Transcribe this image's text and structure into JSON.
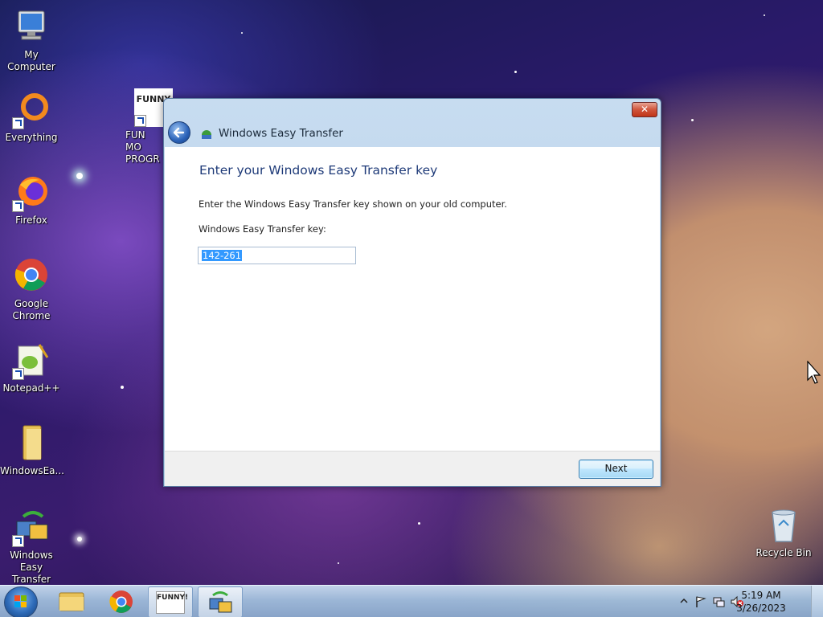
{
  "desktop": {
    "icons": [
      {
        "label": "My Computer",
        "icon": "computer-icon"
      },
      {
        "label": "Everything",
        "icon": "everything-search-icon"
      },
      {
        "label": "FUN MO PROGR",
        "icon": "funny-image-icon",
        "image_text": "FUNNY"
      },
      {
        "label": "Firefox",
        "icon": "firefox-icon"
      },
      {
        "label": "Google Chrome",
        "icon": "chrome-icon"
      },
      {
        "label": "Notepad++",
        "icon": "notepadpp-icon"
      },
      {
        "label": "WindowsEa...",
        "icon": "folder-icon"
      },
      {
        "label": "Windows Easy Transfer",
        "icon": "easy-transfer-icon"
      },
      {
        "label": "Recycle Bin",
        "icon": "recycle-bin-icon"
      }
    ]
  },
  "dialog": {
    "title": "Windows Easy Transfer",
    "close_label": "✕",
    "heading": "Enter your Windows Easy Transfer key",
    "instruction": "Enter the Windows Easy Transfer key shown on your old computer.",
    "key_label": "Windows Easy Transfer key:",
    "key_value": "142-261",
    "next_label": "Next"
  },
  "taskbar": {
    "items": [
      {
        "name": "explorer",
        "icon": "folder-icon"
      },
      {
        "name": "chrome",
        "icon": "chrome-icon"
      },
      {
        "name": "funny",
        "icon": "funny-image-icon",
        "image_text": "FUNNY!"
      },
      {
        "name": "easy-transfer",
        "icon": "easy-transfer-icon"
      }
    ],
    "clock_time": "5:19 AM",
    "clock_date": "3/26/2023"
  },
  "colors": {
    "heading": "#1e3a78",
    "selection": "#3399ff",
    "close_button": "#c03418"
  }
}
